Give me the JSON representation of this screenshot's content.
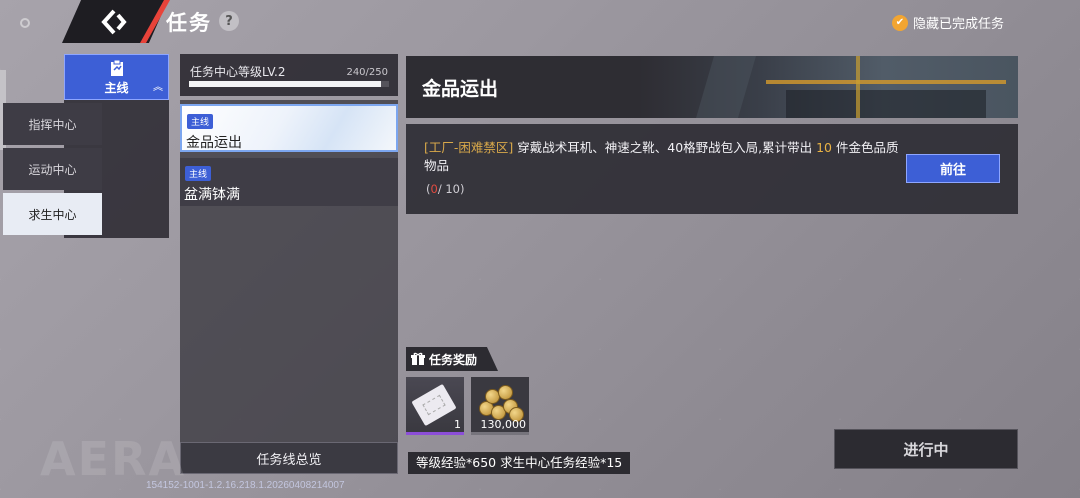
{
  "header": {
    "title": "任务",
    "help_glyph": "?",
    "hide_completed_label": "隐藏已完成任务"
  },
  "categories": {
    "main_label": "主线",
    "sub_items": [
      {
        "label": "指挥中心",
        "active": false
      },
      {
        "label": "运动中心",
        "active": false
      },
      {
        "label": "求生中心",
        "active": true
      }
    ]
  },
  "level": {
    "title": "任务中心等级LV.2",
    "count": "240/250",
    "progress": 0.96
  },
  "tasks": [
    {
      "tag": "主线",
      "name": "金品运出",
      "selected": true
    },
    {
      "tag": "主线",
      "name": "盆满钵满",
      "selected": false
    }
  ],
  "overview_label": "任务线总览",
  "detail": {
    "title": "金品运出",
    "location": "[工厂-困难禁区]",
    "desc_before": " 穿戴战术耳机、神速之靴、40格野战包入局,累计带出 ",
    "desc_number": "10",
    "desc_after": " 件金色品质物品",
    "progress_open": "(",
    "progress_current": "0",
    "progress_rest": "/ 10)",
    "go_label": "前往"
  },
  "rewards": {
    "header": "任务奖励",
    "items": [
      {
        "icon": "ticket-icon",
        "qty": "1",
        "rarity_color": "#8c4ed8"
      },
      {
        "icon": "coins-icon",
        "qty": "130,000",
        "rarity_color": "#76747c"
      }
    ],
    "exp_text": "等级经验*650  求生中心任务经验*15"
  },
  "status_label": "进行中",
  "watermark": "AERA",
  "version": "154152-1001-1.2.16.218.1.20260408214007",
  "colors": {
    "accent_blue": "#3d5fd6",
    "accent_red": "#e8433a",
    "check_orange": "#f2a531",
    "gold_text": "#d8a84a"
  }
}
